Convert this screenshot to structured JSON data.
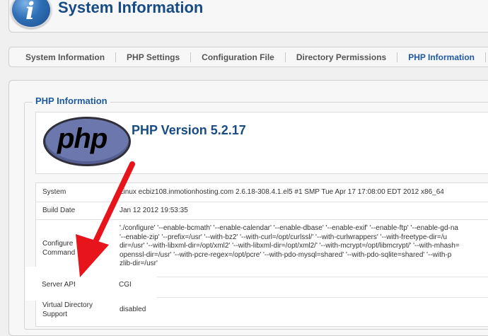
{
  "header": {
    "title": "System Information"
  },
  "tabs": [
    {
      "label": "System Information"
    },
    {
      "label": "PHP Settings"
    },
    {
      "label": "Configuration File"
    },
    {
      "label": "Directory Permissions"
    },
    {
      "label": "PHP Information"
    }
  ],
  "panel": {
    "legend": "PHP Information",
    "logo_text": "php",
    "version": "PHP Version 5.2.17"
  },
  "table": {
    "system_key": "System",
    "system_val": "Linux ecbiz108.inmotionhosting.com 2.6.18-308.4.1.el5 #1 SMP Tue Apr 17 17:08:00 EDT 2012 x86_64",
    "build_key": "Build Date",
    "build_val": "Jan 12 2012 19:53:35",
    "config_key": "Configure\nCommand",
    "config_val": "'./configure' '--enable-bcmath' '--enable-calendar' '--enable-dbase' '--enable-exif' '--enable-ftp' '--enable-gd-na\n'--enable-zip' '--prefix=/usr' '--with-bz2' '--with-curl=/opt/curlssl/' '--with-curlwrappers' '--with-freetype-dir=/u\ndir=/usr' '--with-libxml-dir=/opt/xml2' '--with-libxml-dir=/opt/xml2/' '--with-mcrypt=/opt/libmcrypt/' '--with-mhash=\nopenssl-dir=/usr' '--with-pcre-regex=/opt/pcre' '--with-pdo-mysql=shared' '--with-pdo-sqlite=shared' '--with-p\nzlib-dir=/usr'",
    "api_key": "Server API",
    "api_val": "CGI",
    "vds_key": "Virtual Directory\nSupport",
    "vds_val": "disabled"
  },
  "colors": {
    "title_blue": "#164b86",
    "arrow_red": "#e8141c",
    "active_tab": "#1f5aa0"
  },
  "icons": {
    "header_icon": "info-icon",
    "annotation": "red-arrow"
  }
}
